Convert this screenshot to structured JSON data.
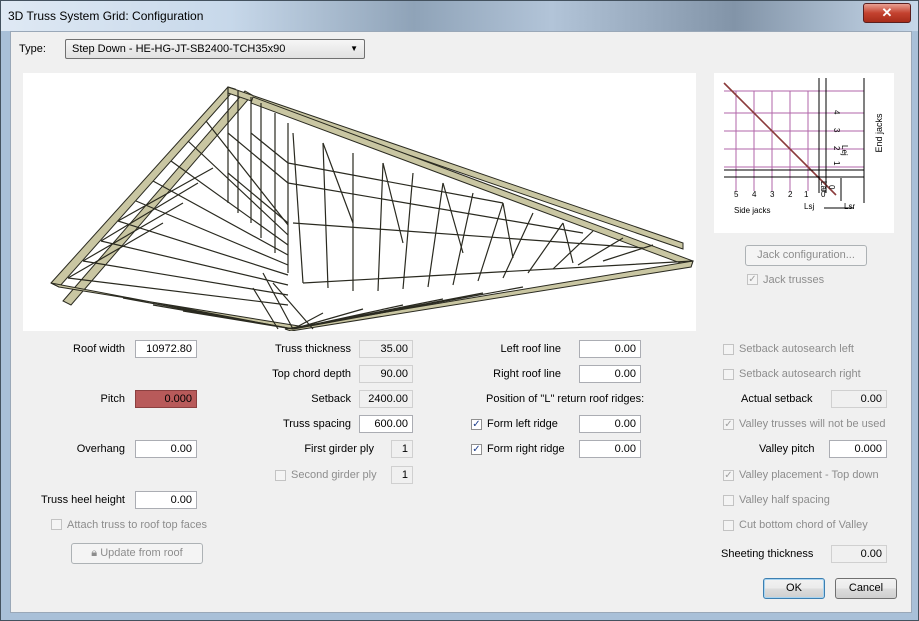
{
  "window": {
    "title": "3D Truss System Grid: Configuration",
    "close_glyph": "✕"
  },
  "type_selector": {
    "label": "Type:",
    "value": "Step Down - HE-HG-JT-SB2400-TCH35x90"
  },
  "col1": {
    "roof_width": {
      "label": "Roof width",
      "value": "10972.80"
    },
    "pitch": {
      "label": "Pitch",
      "value": "0.000"
    },
    "overhang": {
      "label": "Overhang",
      "value": "0.00"
    },
    "truss_heel_height": {
      "label": "Truss heel height",
      "value": "0.00"
    },
    "attach_truss": {
      "label": "Attach truss to roof top faces",
      "checked": false
    },
    "update_from_roof": {
      "label": "Update from roof"
    }
  },
  "col2": {
    "truss_thickness": {
      "label": "Truss thickness",
      "value": "35.00"
    },
    "top_chord_depth": {
      "label": "Top chord depth",
      "value": "90.00"
    },
    "setback": {
      "label": "Setback",
      "value": "2400.00"
    },
    "truss_spacing": {
      "label": "Truss spacing",
      "value": "600.00"
    },
    "first_girder_ply": {
      "label": "First girder ply",
      "value": "1"
    },
    "second_girder_ply": {
      "label": "Second girder ply",
      "value": "1",
      "checked": false
    }
  },
  "col3": {
    "left_roof_line": {
      "label": "Left roof line",
      "value": "0.00"
    },
    "right_roof_line": {
      "label": "Right roof line",
      "value": "0.00"
    },
    "position_label": "Position of \"L\" return roof ridges:",
    "form_left_ridge": {
      "label": "Form left ridge",
      "value": "0.00",
      "checked": true
    },
    "form_right_ridge": {
      "label": "Form right ridge",
      "value": "0.00",
      "checked": true
    }
  },
  "right_panel": {
    "diagram": {
      "numbers_vertical": [
        "4",
        "3",
        "2",
        "1",
        "0"
      ],
      "numbers_horizontal": [
        "5",
        "4",
        "3",
        "2",
        "1",
        "0"
      ],
      "lej": "Lej",
      "lar": "Lar",
      "lsj": "Lsj",
      "lsr": "Lsr",
      "side_jacks": "Side jacks",
      "end_jacks": "End jacks"
    },
    "jack_configuration": "Jack configuration...",
    "jack_trusses": {
      "label": "Jack trusses",
      "checked": true
    },
    "setback_autosearch_left": {
      "label": "Setback autosearch left",
      "checked": false
    },
    "setback_autosearch_right": {
      "label": "Setback autosearch right",
      "checked": false
    },
    "actual_setback": {
      "label": "Actual setback",
      "value": "0.00"
    },
    "valley_not_used": {
      "label": "Valley trusses will not be used",
      "checked": true
    },
    "valley_pitch": {
      "label": "Valley pitch",
      "value": "0.000"
    },
    "valley_placement": {
      "label": "Valley placement - Top down",
      "checked": true
    },
    "valley_half_spacing": {
      "label": "Valley half spacing",
      "checked": false
    },
    "cut_bottom_chord": {
      "label": "Cut bottom chord of Valley",
      "checked": false
    },
    "sheeting_thickness": {
      "label": "Sheeting thickness",
      "value": "0.00"
    }
  },
  "buttons": {
    "ok": "OK",
    "cancel": "Cancel"
  },
  "colors": {
    "pitch_highlight": "#b85a5a",
    "truss_fill": "#c9c6a2",
    "diagram_magenta": "#b066a8"
  }
}
